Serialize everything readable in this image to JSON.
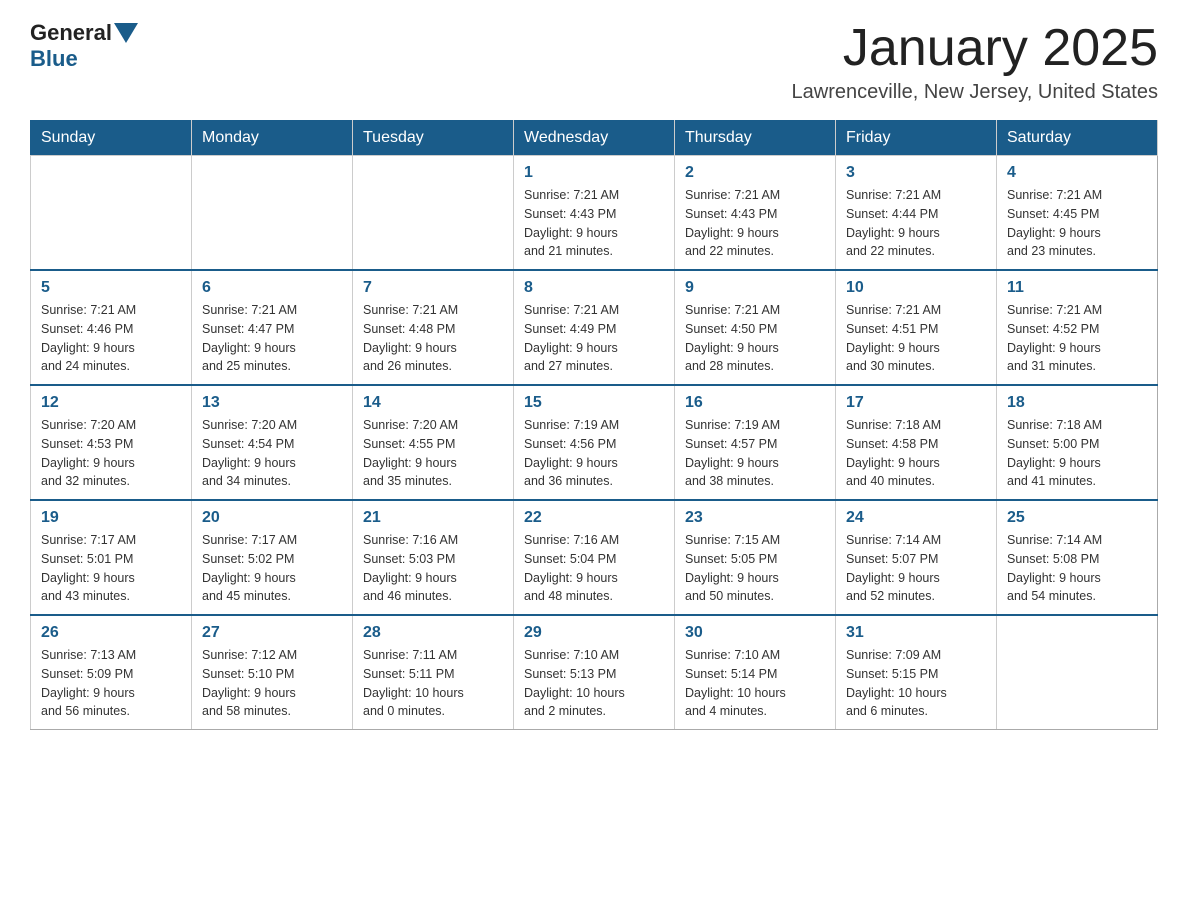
{
  "header": {
    "logo": {
      "general": "General",
      "blue": "Blue"
    },
    "title": "January 2025",
    "location": "Lawrenceville, New Jersey, United States"
  },
  "weekdays": [
    "Sunday",
    "Monday",
    "Tuesday",
    "Wednesday",
    "Thursday",
    "Friday",
    "Saturday"
  ],
  "weeks": [
    [
      {
        "day": "",
        "info": ""
      },
      {
        "day": "",
        "info": ""
      },
      {
        "day": "",
        "info": ""
      },
      {
        "day": "1",
        "info": "Sunrise: 7:21 AM\nSunset: 4:43 PM\nDaylight: 9 hours\nand 21 minutes."
      },
      {
        "day": "2",
        "info": "Sunrise: 7:21 AM\nSunset: 4:43 PM\nDaylight: 9 hours\nand 22 minutes."
      },
      {
        "day": "3",
        "info": "Sunrise: 7:21 AM\nSunset: 4:44 PM\nDaylight: 9 hours\nand 22 minutes."
      },
      {
        "day": "4",
        "info": "Sunrise: 7:21 AM\nSunset: 4:45 PM\nDaylight: 9 hours\nand 23 minutes."
      }
    ],
    [
      {
        "day": "5",
        "info": "Sunrise: 7:21 AM\nSunset: 4:46 PM\nDaylight: 9 hours\nand 24 minutes."
      },
      {
        "day": "6",
        "info": "Sunrise: 7:21 AM\nSunset: 4:47 PM\nDaylight: 9 hours\nand 25 minutes."
      },
      {
        "day": "7",
        "info": "Sunrise: 7:21 AM\nSunset: 4:48 PM\nDaylight: 9 hours\nand 26 minutes."
      },
      {
        "day": "8",
        "info": "Sunrise: 7:21 AM\nSunset: 4:49 PM\nDaylight: 9 hours\nand 27 minutes."
      },
      {
        "day": "9",
        "info": "Sunrise: 7:21 AM\nSunset: 4:50 PM\nDaylight: 9 hours\nand 28 minutes."
      },
      {
        "day": "10",
        "info": "Sunrise: 7:21 AM\nSunset: 4:51 PM\nDaylight: 9 hours\nand 30 minutes."
      },
      {
        "day": "11",
        "info": "Sunrise: 7:21 AM\nSunset: 4:52 PM\nDaylight: 9 hours\nand 31 minutes."
      }
    ],
    [
      {
        "day": "12",
        "info": "Sunrise: 7:20 AM\nSunset: 4:53 PM\nDaylight: 9 hours\nand 32 minutes."
      },
      {
        "day": "13",
        "info": "Sunrise: 7:20 AM\nSunset: 4:54 PM\nDaylight: 9 hours\nand 34 minutes."
      },
      {
        "day": "14",
        "info": "Sunrise: 7:20 AM\nSunset: 4:55 PM\nDaylight: 9 hours\nand 35 minutes."
      },
      {
        "day": "15",
        "info": "Sunrise: 7:19 AM\nSunset: 4:56 PM\nDaylight: 9 hours\nand 36 minutes."
      },
      {
        "day": "16",
        "info": "Sunrise: 7:19 AM\nSunset: 4:57 PM\nDaylight: 9 hours\nand 38 minutes."
      },
      {
        "day": "17",
        "info": "Sunrise: 7:18 AM\nSunset: 4:58 PM\nDaylight: 9 hours\nand 40 minutes."
      },
      {
        "day": "18",
        "info": "Sunrise: 7:18 AM\nSunset: 5:00 PM\nDaylight: 9 hours\nand 41 minutes."
      }
    ],
    [
      {
        "day": "19",
        "info": "Sunrise: 7:17 AM\nSunset: 5:01 PM\nDaylight: 9 hours\nand 43 minutes."
      },
      {
        "day": "20",
        "info": "Sunrise: 7:17 AM\nSunset: 5:02 PM\nDaylight: 9 hours\nand 45 minutes."
      },
      {
        "day": "21",
        "info": "Sunrise: 7:16 AM\nSunset: 5:03 PM\nDaylight: 9 hours\nand 46 minutes."
      },
      {
        "day": "22",
        "info": "Sunrise: 7:16 AM\nSunset: 5:04 PM\nDaylight: 9 hours\nand 48 minutes."
      },
      {
        "day": "23",
        "info": "Sunrise: 7:15 AM\nSunset: 5:05 PM\nDaylight: 9 hours\nand 50 minutes."
      },
      {
        "day": "24",
        "info": "Sunrise: 7:14 AM\nSunset: 5:07 PM\nDaylight: 9 hours\nand 52 minutes."
      },
      {
        "day": "25",
        "info": "Sunrise: 7:14 AM\nSunset: 5:08 PM\nDaylight: 9 hours\nand 54 minutes."
      }
    ],
    [
      {
        "day": "26",
        "info": "Sunrise: 7:13 AM\nSunset: 5:09 PM\nDaylight: 9 hours\nand 56 minutes."
      },
      {
        "day": "27",
        "info": "Sunrise: 7:12 AM\nSunset: 5:10 PM\nDaylight: 9 hours\nand 58 minutes."
      },
      {
        "day": "28",
        "info": "Sunrise: 7:11 AM\nSunset: 5:11 PM\nDaylight: 10 hours\nand 0 minutes."
      },
      {
        "day": "29",
        "info": "Sunrise: 7:10 AM\nSunset: 5:13 PM\nDaylight: 10 hours\nand 2 minutes."
      },
      {
        "day": "30",
        "info": "Sunrise: 7:10 AM\nSunset: 5:14 PM\nDaylight: 10 hours\nand 4 minutes."
      },
      {
        "day": "31",
        "info": "Sunrise: 7:09 AM\nSunset: 5:15 PM\nDaylight: 10 hours\nand 6 minutes."
      },
      {
        "day": "",
        "info": ""
      }
    ]
  ]
}
